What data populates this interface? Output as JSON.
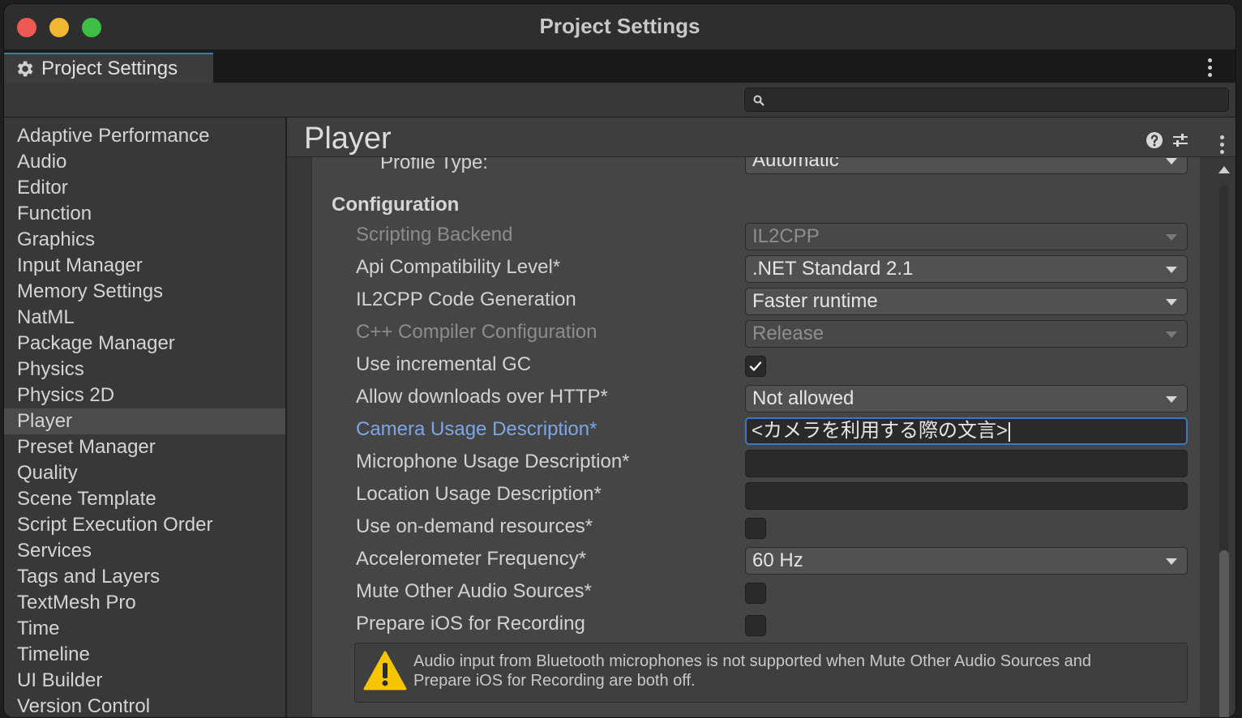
{
  "window": {
    "title": "Project Settings"
  },
  "tab": {
    "label": "Project Settings",
    "icon": "gear-icon"
  },
  "search": {
    "value": "",
    "icon": "search-icon"
  },
  "sidebar": {
    "items": [
      {
        "label": "Adaptive Performance"
      },
      {
        "label": "Audio"
      },
      {
        "label": "Editor"
      },
      {
        "label": "Function"
      },
      {
        "label": "Graphics"
      },
      {
        "label": "Input Manager"
      },
      {
        "label": "Memory Settings"
      },
      {
        "label": "NatML"
      },
      {
        "label": "Package Manager"
      },
      {
        "label": "Physics"
      },
      {
        "label": "Physics 2D"
      },
      {
        "label": "Player",
        "selected": true
      },
      {
        "label": "Preset Manager"
      },
      {
        "label": "Quality"
      },
      {
        "label": "Scene Template"
      },
      {
        "label": "Script Execution Order"
      },
      {
        "label": "Services"
      },
      {
        "label": "Tags and Layers"
      },
      {
        "label": "TextMesh Pro"
      },
      {
        "label": "Time"
      },
      {
        "label": "Timeline"
      },
      {
        "label": "UI Builder"
      },
      {
        "label": "Version Control"
      }
    ]
  },
  "page": {
    "title": "Player",
    "icons": [
      "help-icon",
      "preset-sliders-icon",
      "more-options-icon"
    ]
  },
  "settings": {
    "profile_type": {
      "label": "Profile Type:",
      "value": "Automatic"
    },
    "section_title": "Configuration",
    "scripting_backend": {
      "label": "Scripting Backend",
      "value": "IL2CPP",
      "disabled": true
    },
    "api_compat": {
      "label": "Api Compatibility Level*",
      "value": ".NET Standard 2.1"
    },
    "il2cpp_codegen": {
      "label": "IL2CPP Code Generation",
      "value": "Faster runtime"
    },
    "cpp_compiler": {
      "label": "C++ Compiler Configuration",
      "value": "Release",
      "disabled": true
    },
    "incremental_gc": {
      "label": "Use incremental GC",
      "checked": true
    },
    "allow_http": {
      "label": "Allow downloads over HTTP*",
      "value": "Not allowed"
    },
    "camera_usage": {
      "label": "Camera Usage Description*",
      "value": "<カメラを利用する際の文言>"
    },
    "microphone_usage": {
      "label": "Microphone Usage Description*",
      "value": ""
    },
    "location_usage": {
      "label": "Location Usage Description*",
      "value": ""
    },
    "on_demand": {
      "label": "Use on-demand resources*",
      "checked": false
    },
    "accelerometer": {
      "label": "Accelerometer Frequency*",
      "value": "60 Hz"
    },
    "mute_audio": {
      "label": "Mute Other Audio Sources*",
      "checked": false
    },
    "prepare_ios": {
      "label": "Prepare iOS for Recording",
      "checked": false
    },
    "warning": {
      "icon": "warning-icon",
      "line1": "Audio input from Bluetooth microphones is not supported when Mute Other Audio Sources and",
      "line2": "Prepare iOS for Recording are both off."
    }
  },
  "colors": {
    "accent": "#3a79bb",
    "link_label": "#7ca6e6",
    "warning": "#f7c500"
  }
}
